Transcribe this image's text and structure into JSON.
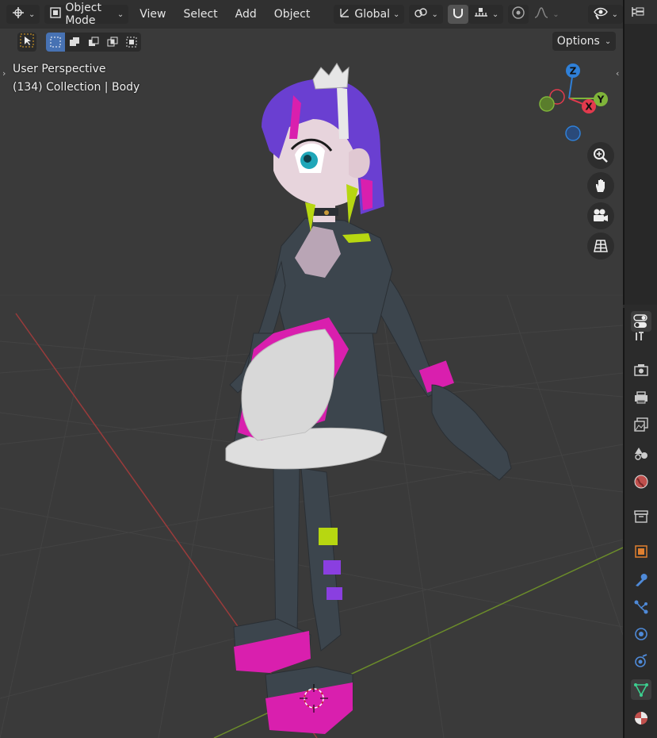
{
  "header": {
    "editor_type_icon": "globe-transform-icon",
    "mode_label": "Object Mode",
    "menus": [
      "View",
      "Select",
      "Add",
      "Object"
    ],
    "transform_orientation": "Global"
  },
  "toolbar": {
    "options_label": "Options"
  },
  "viewport": {
    "perspective_label": "User Perspective",
    "collection_label": "(134) Collection | Body"
  },
  "gizmo": {
    "z_label": "Z",
    "y_label": "Y",
    "x_label": "X",
    "colors": {
      "x": "#e23a4d",
      "y": "#7fb43a",
      "z": "#2f80d8"
    }
  },
  "colors": {
    "viewport_bg": "#3a3a3a",
    "grid_line": "#4a4a4a",
    "x_axis": "#9a3b3b",
    "y_axis": "#6b8c2a",
    "accent_select": "#4772b3",
    "hair": "#6a3fd1",
    "suit": "#3c454d",
    "magenta": "#d91fae",
    "lime": "#b7d711",
    "apron": "#d8d8d8",
    "skin": "#e7d4dc"
  }
}
